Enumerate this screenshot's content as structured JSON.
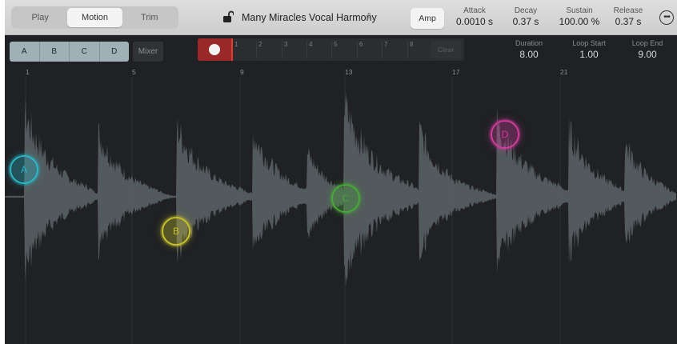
{
  "header": {
    "modes": [
      {
        "label": "Play",
        "active": false
      },
      {
        "label": "Motion",
        "active": true
      },
      {
        "label": "Trim",
        "active": false
      }
    ],
    "preset_name": "Many Miracles Vocal Harmony",
    "preset_chevron": "⇕",
    "amp_label": "Amp",
    "params": [
      {
        "label": "Attack",
        "value": "0.0010 s"
      },
      {
        "label": "Decay",
        "value": "0.37 s"
      },
      {
        "label": "Sustain",
        "value": "100.00 %"
      },
      {
        "label": "Release",
        "value": "0.37 s"
      }
    ],
    "more_glyph": "•••"
  },
  "toolbar": {
    "markers": [
      "A",
      "B",
      "C",
      "D"
    ],
    "mixer_label": "Mixer",
    "steps": [
      "1",
      "2",
      "3",
      "4",
      "5",
      "6",
      "7",
      "8"
    ],
    "clear_label": "Clear",
    "duration": {
      "label": "Duration",
      "value": "8.00"
    },
    "loop_start": {
      "label": "Loop Start",
      "value": "1.00"
    },
    "loop_end": {
      "label": "Loop End",
      "value": "9.00"
    }
  },
  "ruler": [
    "1",
    "5",
    "9",
    "13",
    "17",
    "21"
  ],
  "motion_markers": [
    {
      "label": "A",
      "color": "#2bb6c8"
    },
    {
      "label": "B",
      "color": "#c9c02c"
    },
    {
      "label": "C",
      "color": "#49a838"
    },
    {
      "label": "D",
      "color": "#d23b9c"
    }
  ],
  "colors": {
    "record": "#9a2a2a",
    "playhead": "#e33b2e",
    "waveform": "#5d6467"
  }
}
